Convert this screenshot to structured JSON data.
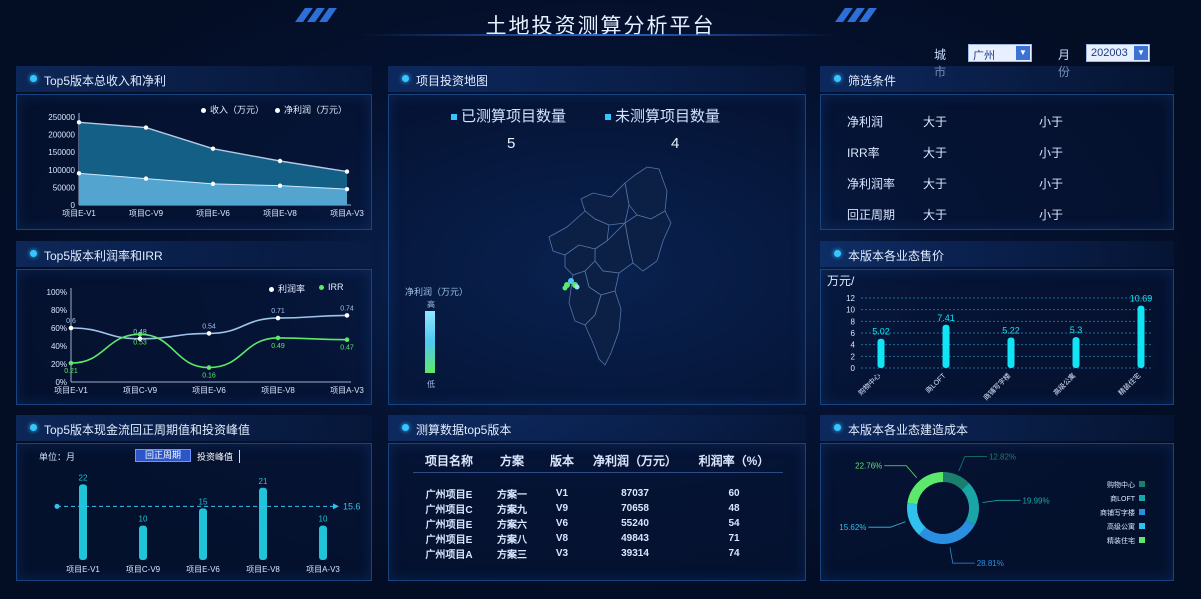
{
  "header": {
    "title": "土地投资测算分析平台"
  },
  "filters": {
    "city_label": "城市",
    "city_value": "广州",
    "month_label": "月份",
    "month_value": "202003"
  },
  "panels": {
    "income": {
      "title": "Top5版本总收入和净利"
    },
    "profit_rate": {
      "title": "Top5版本利润率和IRR"
    },
    "cashflow": {
      "title": "Top5版本现金流回正周期值和投资峰值"
    },
    "map": {
      "title": "项目投资地图"
    },
    "top5": {
      "title": "测算数据top5版本"
    },
    "filter": {
      "title": "筛选条件"
    },
    "price": {
      "title": "本版本各业态售价"
    },
    "cost": {
      "title": "本版本各业态建造成本"
    }
  },
  "map": {
    "measured_label": "已测算项目数量",
    "measured_count": "5",
    "unmeasured_label": "未测算项目数量",
    "unmeasured_count": "4",
    "legend_title": "净利润（万元）",
    "legend_high": "高",
    "legend_low": "低"
  },
  "filter_conditions": [
    {
      "name": "净利润",
      "gt": "大于",
      "lt": "小于"
    },
    {
      "name": "IRR率",
      "gt": "大于",
      "lt": "小于"
    },
    {
      "name": "净利润率",
      "gt": "大于",
      "lt": "小于"
    },
    {
      "name": "回正周期",
      "gt": "大于",
      "lt": "小于"
    }
  ],
  "table": {
    "headers": [
      "项目名称",
      "方案",
      "版本",
      "净利润（万元）",
      "利润率（%）"
    ],
    "rows": [
      [
        "广州项目E",
        "方案一",
        "V1",
        "87037",
        "60"
      ],
      [
        "广州项目C",
        "方案九",
        "V9",
        "70658",
        "48"
      ],
      [
        "广州项目E",
        "方案六",
        "V6",
        "55240",
        "54"
      ],
      [
        "广州项目E",
        "方案八",
        "V8",
        "49843",
        "71"
      ],
      [
        "广州项目A",
        "方案三",
        "V3",
        "39314",
        "74"
      ]
    ]
  },
  "colors": {
    "accent": "#36c5ff",
    "income": "#1e88b8",
    "profit": "#4bb6e6",
    "green": "#5ee86b",
    "cyan": "#11e5f5"
  },
  "chart_data": [
    {
      "id": "income",
      "type": "area",
      "categories": [
        "项目E-V1",
        "项目C-V9",
        "项目E-V6",
        "项目E-V8",
        "项目A-V3"
      ],
      "series": [
        {
          "name": "收入（万元）",
          "values": [
            235000,
            220000,
            160000,
            125000,
            95000
          ]
        },
        {
          "name": "净利润（万元）",
          "values": [
            90000,
            75000,
            60000,
            55000,
            45000
          ]
        }
      ],
      "ylim": [
        0,
        250000
      ],
      "yticks": [
        "0",
        "50000",
        "100000",
        "150000",
        "200000",
        "250000"
      ],
      "legend": "top-right"
    },
    {
      "id": "profit_rate",
      "type": "line",
      "categories": [
        "项目E-V1",
        "项目C-V9",
        "项目E-V6",
        "项目E-V8",
        "项目A-V3"
      ],
      "series": [
        {
          "name": "利润率",
          "values": [
            0.6,
            0.48,
            0.54,
            0.71,
            0.74
          ]
        },
        {
          "name": "IRR",
          "values": [
            0.21,
            0.53,
            0.16,
            0.49,
            0.47
          ]
        }
      ],
      "ylim": [
        0,
        1
      ],
      "yticks": [
        "0%",
        "20%",
        "40%",
        "60%",
        "80%",
        "100%"
      ],
      "legend": "top-right"
    },
    {
      "id": "cashflow",
      "type": "bar",
      "unit_label": "单位：月",
      "toggle": [
        "回正周期",
        "投资峰值"
      ],
      "categories": [
        "项目E-V1",
        "项目C-V9",
        "项目E-V6",
        "项目E-V8",
        "项目A-V3"
      ],
      "values": [
        22,
        10,
        15,
        21,
        10
      ],
      "average": 15.6,
      "ylim": [
        0,
        25
      ]
    },
    {
      "id": "price",
      "type": "bar",
      "unit_label": "万元/",
      "categories": [
        "购物中心",
        "商LOFT",
        "商铺写字楼",
        "高级公寓",
        "精装住宅"
      ],
      "values": [
        5.02,
        7.41,
        5.22,
        5.3,
        10.69
      ],
      "ylim": [
        0,
        12
      ],
      "yticks": [
        "0",
        "2",
        "4",
        "6",
        "8",
        "10",
        "12"
      ]
    },
    {
      "id": "cost",
      "type": "pie",
      "labels": [
        "购物中心",
        "商LOFT",
        "商铺写字楼",
        "高级公寓",
        "精装住宅"
      ],
      "values": [
        12.82,
        19.99,
        28.81,
        15.62,
        22.76
      ],
      "value_labels": [
        "12.82%",
        "19.99%",
        "28.81%",
        "15.62%",
        "22.76%"
      ],
      "colors": [
        "#1b7f6e",
        "#1aa6a6",
        "#2a8fe0",
        "#2fc2ee",
        "#5ee86b"
      ],
      "legend": "right"
    }
  ]
}
